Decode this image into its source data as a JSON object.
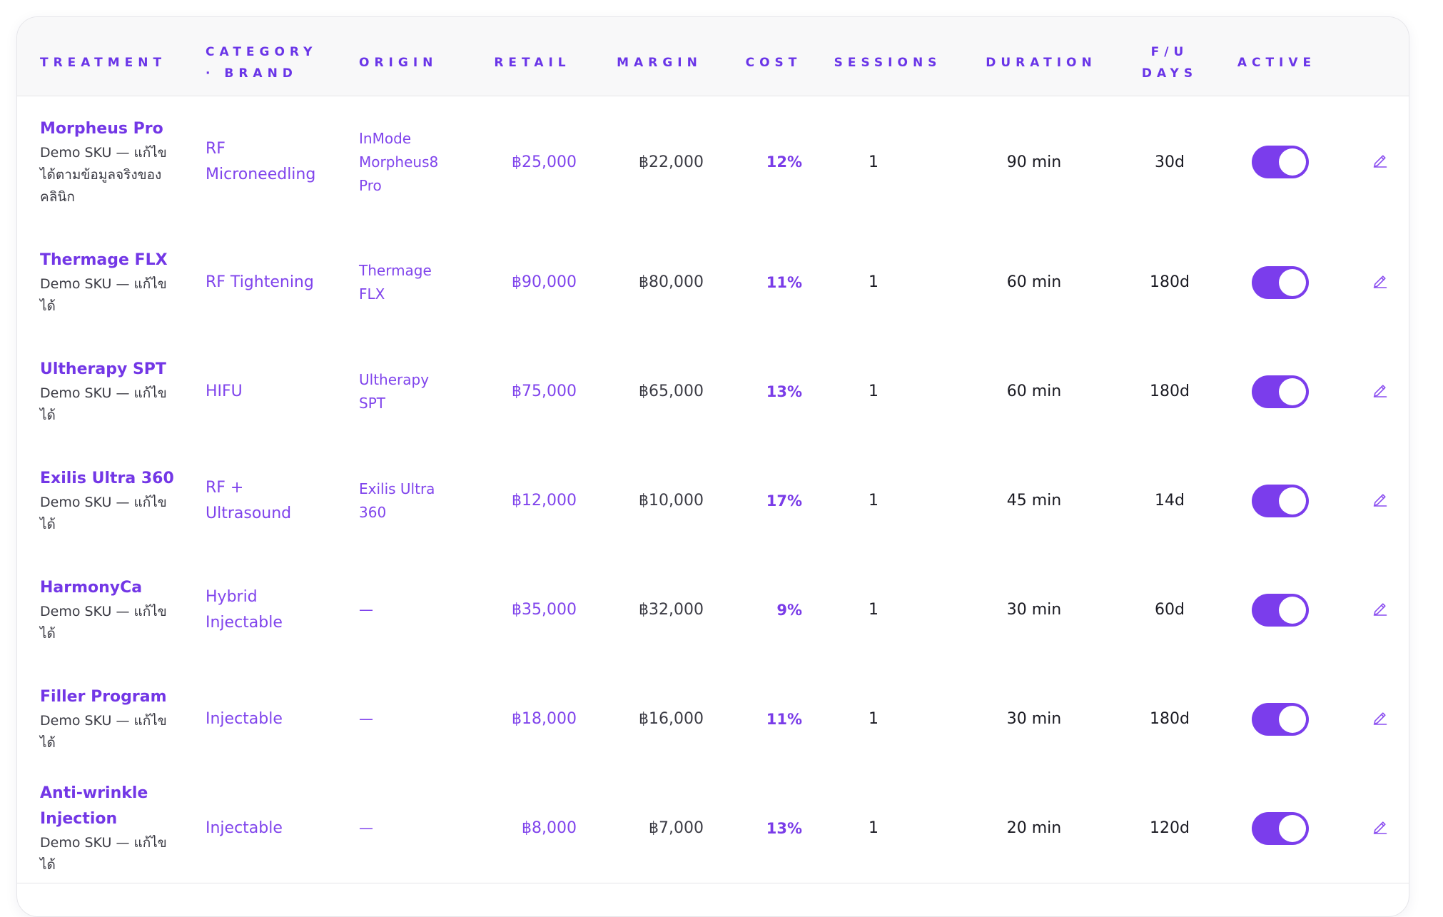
{
  "columns": {
    "treatment": "TREATMENT",
    "category_brand": "CATEGORY · BRAND",
    "origin": "ORIGIN",
    "retail": "RETAIL",
    "margin": "MARGIN",
    "cost": "COST",
    "sessions": "SESSIONS",
    "duration": "DURATION",
    "fu_days": "F/U DAYS",
    "active": "ACTIVE"
  },
  "colors": {
    "accent": "#7b3dec",
    "text_dark": "#1a1a22",
    "header_bg": "#f8f8f9"
  },
  "rows": [
    {
      "name": "Morpheus Pro",
      "sub": "Demo SKU — แก้ไขได้ตามข้อมูลจริงของคลินิก",
      "category": "RF Microneedling",
      "origin": "InMode Morpheus8 Pro",
      "retail": "฿25,000",
      "margin": "฿22,000",
      "cost": "12%",
      "sessions": "1",
      "duration": "90 min",
      "fu": "30d",
      "active": true
    },
    {
      "name": "Thermage FLX",
      "sub": "Demo SKU — แก้ไขได้",
      "category": "RF Tightening",
      "origin": "Thermage FLX",
      "retail": "฿90,000",
      "margin": "฿80,000",
      "cost": "11%",
      "sessions": "1",
      "duration": "60 min",
      "fu": "180d",
      "active": true
    },
    {
      "name": "Ultherapy SPT",
      "sub": "Demo SKU — แก้ไขได้",
      "category": "HIFU",
      "origin": "Ultherapy SPT",
      "retail": "฿75,000",
      "margin": "฿65,000",
      "cost": "13%",
      "sessions": "1",
      "duration": "60 min",
      "fu": "180d",
      "active": true
    },
    {
      "name": "Exilis Ultra 360",
      "sub": "Demo SKU — แก้ไขได้",
      "category": "RF + Ultrasound",
      "origin": "Exilis Ultra 360",
      "retail": "฿12,000",
      "margin": "฿10,000",
      "cost": "17%",
      "sessions": "1",
      "duration": "45 min",
      "fu": "14d",
      "active": true
    },
    {
      "name": "HarmonyCa",
      "sub": "Demo SKU — แก้ไขได้",
      "category": "Hybrid Injectable",
      "origin": "—",
      "retail": "฿35,000",
      "margin": "฿32,000",
      "cost": "9%",
      "sessions": "1",
      "duration": "30 min",
      "fu": "60d",
      "active": true
    },
    {
      "name": "Filler Program",
      "sub": "Demo SKU — แก้ไขได้",
      "category": "Injectable",
      "origin": "—",
      "retail": "฿18,000",
      "margin": "฿16,000",
      "cost": "11%",
      "sessions": "1",
      "duration": "30 min",
      "fu": "180d",
      "active": true
    },
    {
      "name": "Anti-wrinkle Injection",
      "sub": "Demo SKU — แก้ไขได้",
      "category": "Injectable",
      "origin": "—",
      "retail": "฿8,000",
      "margin": "฿7,000",
      "cost": "13%",
      "sessions": "1",
      "duration": "20 min",
      "fu": "120d",
      "active": true
    }
  ]
}
